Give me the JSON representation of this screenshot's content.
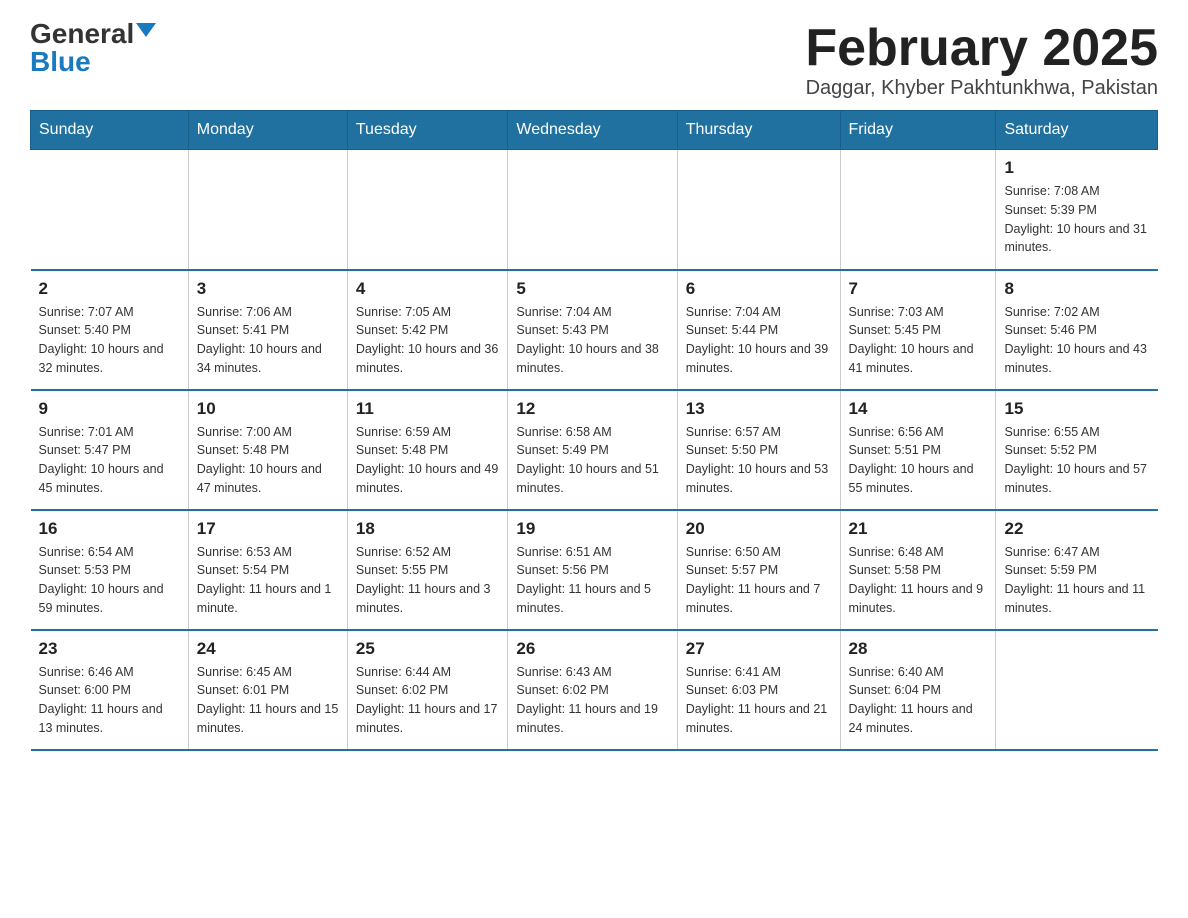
{
  "header": {
    "logo": {
      "general": "General",
      "blue": "Blue",
      "triangle": "▲"
    },
    "title": "February 2025",
    "location": "Daggar, Khyber Pakhtunkhwa, Pakistan"
  },
  "weekdays": [
    "Sunday",
    "Monday",
    "Tuesday",
    "Wednesday",
    "Thursday",
    "Friday",
    "Saturday"
  ],
  "weeks": [
    [
      {
        "day": "",
        "info": ""
      },
      {
        "day": "",
        "info": ""
      },
      {
        "day": "",
        "info": ""
      },
      {
        "day": "",
        "info": ""
      },
      {
        "day": "",
        "info": ""
      },
      {
        "day": "",
        "info": ""
      },
      {
        "day": "1",
        "info": "Sunrise: 7:08 AM\nSunset: 5:39 PM\nDaylight: 10 hours and 31 minutes."
      }
    ],
    [
      {
        "day": "2",
        "info": "Sunrise: 7:07 AM\nSunset: 5:40 PM\nDaylight: 10 hours and 32 minutes."
      },
      {
        "day": "3",
        "info": "Sunrise: 7:06 AM\nSunset: 5:41 PM\nDaylight: 10 hours and 34 minutes."
      },
      {
        "day": "4",
        "info": "Sunrise: 7:05 AM\nSunset: 5:42 PM\nDaylight: 10 hours and 36 minutes."
      },
      {
        "day": "5",
        "info": "Sunrise: 7:04 AM\nSunset: 5:43 PM\nDaylight: 10 hours and 38 minutes."
      },
      {
        "day": "6",
        "info": "Sunrise: 7:04 AM\nSunset: 5:44 PM\nDaylight: 10 hours and 39 minutes."
      },
      {
        "day": "7",
        "info": "Sunrise: 7:03 AM\nSunset: 5:45 PM\nDaylight: 10 hours and 41 minutes."
      },
      {
        "day": "8",
        "info": "Sunrise: 7:02 AM\nSunset: 5:46 PM\nDaylight: 10 hours and 43 minutes."
      }
    ],
    [
      {
        "day": "9",
        "info": "Sunrise: 7:01 AM\nSunset: 5:47 PM\nDaylight: 10 hours and 45 minutes."
      },
      {
        "day": "10",
        "info": "Sunrise: 7:00 AM\nSunset: 5:48 PM\nDaylight: 10 hours and 47 minutes."
      },
      {
        "day": "11",
        "info": "Sunrise: 6:59 AM\nSunset: 5:48 PM\nDaylight: 10 hours and 49 minutes."
      },
      {
        "day": "12",
        "info": "Sunrise: 6:58 AM\nSunset: 5:49 PM\nDaylight: 10 hours and 51 minutes."
      },
      {
        "day": "13",
        "info": "Sunrise: 6:57 AM\nSunset: 5:50 PM\nDaylight: 10 hours and 53 minutes."
      },
      {
        "day": "14",
        "info": "Sunrise: 6:56 AM\nSunset: 5:51 PM\nDaylight: 10 hours and 55 minutes."
      },
      {
        "day": "15",
        "info": "Sunrise: 6:55 AM\nSunset: 5:52 PM\nDaylight: 10 hours and 57 minutes."
      }
    ],
    [
      {
        "day": "16",
        "info": "Sunrise: 6:54 AM\nSunset: 5:53 PM\nDaylight: 10 hours and 59 minutes."
      },
      {
        "day": "17",
        "info": "Sunrise: 6:53 AM\nSunset: 5:54 PM\nDaylight: 11 hours and 1 minute."
      },
      {
        "day": "18",
        "info": "Sunrise: 6:52 AM\nSunset: 5:55 PM\nDaylight: 11 hours and 3 minutes."
      },
      {
        "day": "19",
        "info": "Sunrise: 6:51 AM\nSunset: 5:56 PM\nDaylight: 11 hours and 5 minutes."
      },
      {
        "day": "20",
        "info": "Sunrise: 6:50 AM\nSunset: 5:57 PM\nDaylight: 11 hours and 7 minutes."
      },
      {
        "day": "21",
        "info": "Sunrise: 6:48 AM\nSunset: 5:58 PM\nDaylight: 11 hours and 9 minutes."
      },
      {
        "day": "22",
        "info": "Sunrise: 6:47 AM\nSunset: 5:59 PM\nDaylight: 11 hours and 11 minutes."
      }
    ],
    [
      {
        "day": "23",
        "info": "Sunrise: 6:46 AM\nSunset: 6:00 PM\nDaylight: 11 hours and 13 minutes."
      },
      {
        "day": "24",
        "info": "Sunrise: 6:45 AM\nSunset: 6:01 PM\nDaylight: 11 hours and 15 minutes."
      },
      {
        "day": "25",
        "info": "Sunrise: 6:44 AM\nSunset: 6:02 PM\nDaylight: 11 hours and 17 minutes."
      },
      {
        "day": "26",
        "info": "Sunrise: 6:43 AM\nSunset: 6:02 PM\nDaylight: 11 hours and 19 minutes."
      },
      {
        "day": "27",
        "info": "Sunrise: 6:41 AM\nSunset: 6:03 PM\nDaylight: 11 hours and 21 minutes."
      },
      {
        "day": "28",
        "info": "Sunrise: 6:40 AM\nSunset: 6:04 PM\nDaylight: 11 hours and 24 minutes."
      },
      {
        "day": "",
        "info": ""
      }
    ]
  ]
}
